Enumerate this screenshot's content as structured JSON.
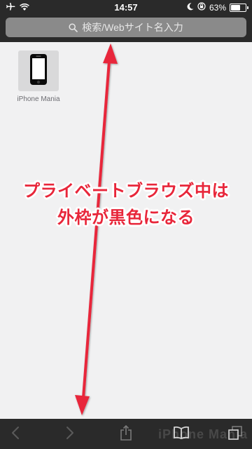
{
  "status_bar": {
    "time": "14:57",
    "battery_percent": "63%",
    "battery_level": 0.63,
    "icons": [
      "airplane-icon",
      "wifi-icon",
      "moon-icon",
      "rotation-lock-icon",
      "battery-icon"
    ]
  },
  "url_bar": {
    "placeholder": "検索/Webサイト名入力",
    "icon": "search-icon"
  },
  "favorites": [
    {
      "label": "iPhone Mania",
      "icon": "iphone-icon"
    }
  ],
  "annotation": {
    "line1": "プライベートブラウズ中は",
    "line2": "外枠が黒色になる",
    "color": "#e8263a"
  },
  "toolbar": {
    "buttons": [
      "back-icon",
      "forward-icon",
      "share-icon",
      "bookmarks-icon",
      "tabs-icon"
    ],
    "watermark": "iPhone Mania"
  },
  "colors": {
    "chrome": "#2a2a2a",
    "content_bg": "#f1f1f2",
    "url_bar": "#8a8a8a"
  }
}
